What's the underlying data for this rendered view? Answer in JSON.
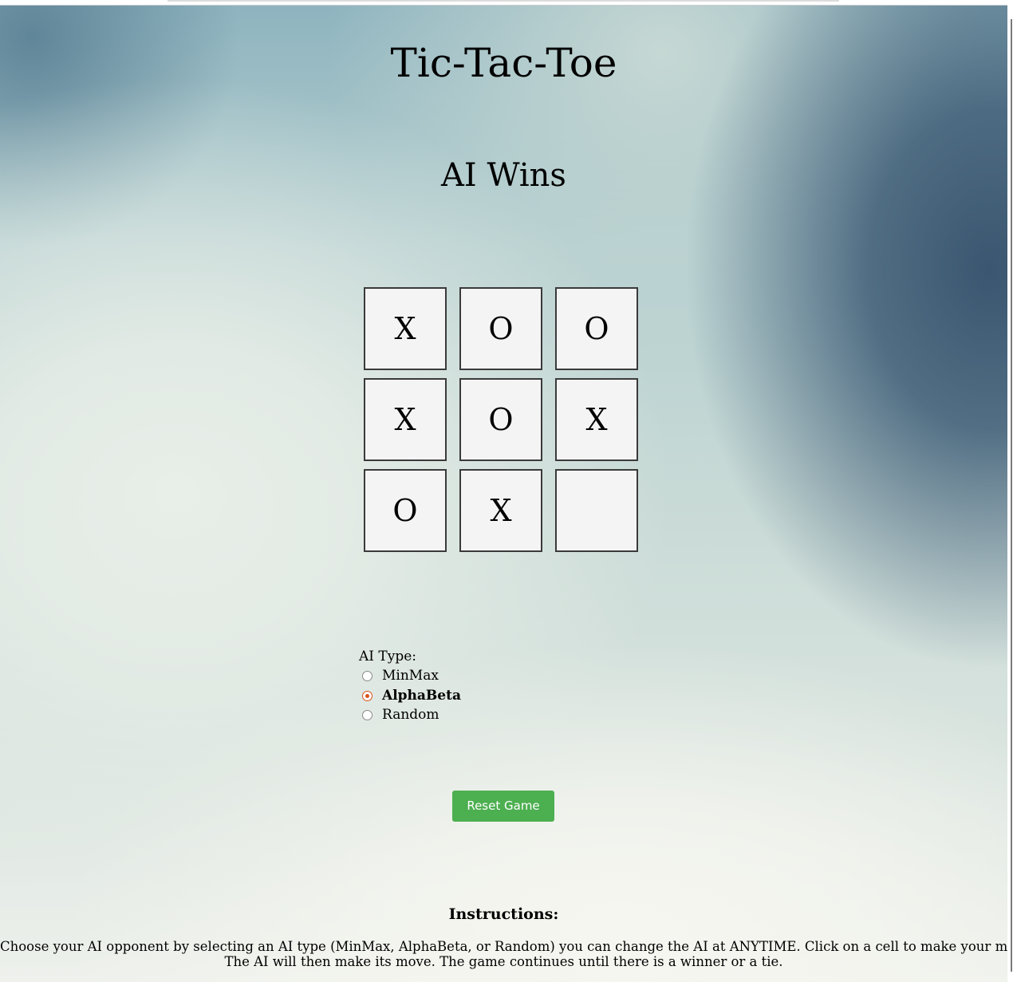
{
  "game": {
    "title": "Tic-Tac-Toe",
    "status": "AI Wins",
    "board": [
      [
        "X",
        "O",
        "O"
      ],
      [
        "X",
        "O",
        "X"
      ],
      [
        "O",
        "X",
        ""
      ]
    ]
  },
  "ai_type": {
    "label": "AI Type:",
    "options": [
      {
        "label": "MinMax",
        "selected": false
      },
      {
        "label": "AlphaBeta",
        "selected": true
      },
      {
        "label": "Random",
        "selected": false
      }
    ]
  },
  "reset_button": {
    "label": "Reset Game"
  },
  "instructions": {
    "title": "Instructions:",
    "line1": "Choose your AI opponent by selecting an AI type (MinMax, AlphaBeta, or Random) you can change the AI at ANYTIME. Click on a cell to make your move.",
    "line2": "The AI will then make its move. The game continues until there is a winner or a tie."
  },
  "colors": {
    "accent_button": "#4caf50",
    "radio_selected": "#d9541e",
    "cell_background": "#f4f4f4"
  }
}
